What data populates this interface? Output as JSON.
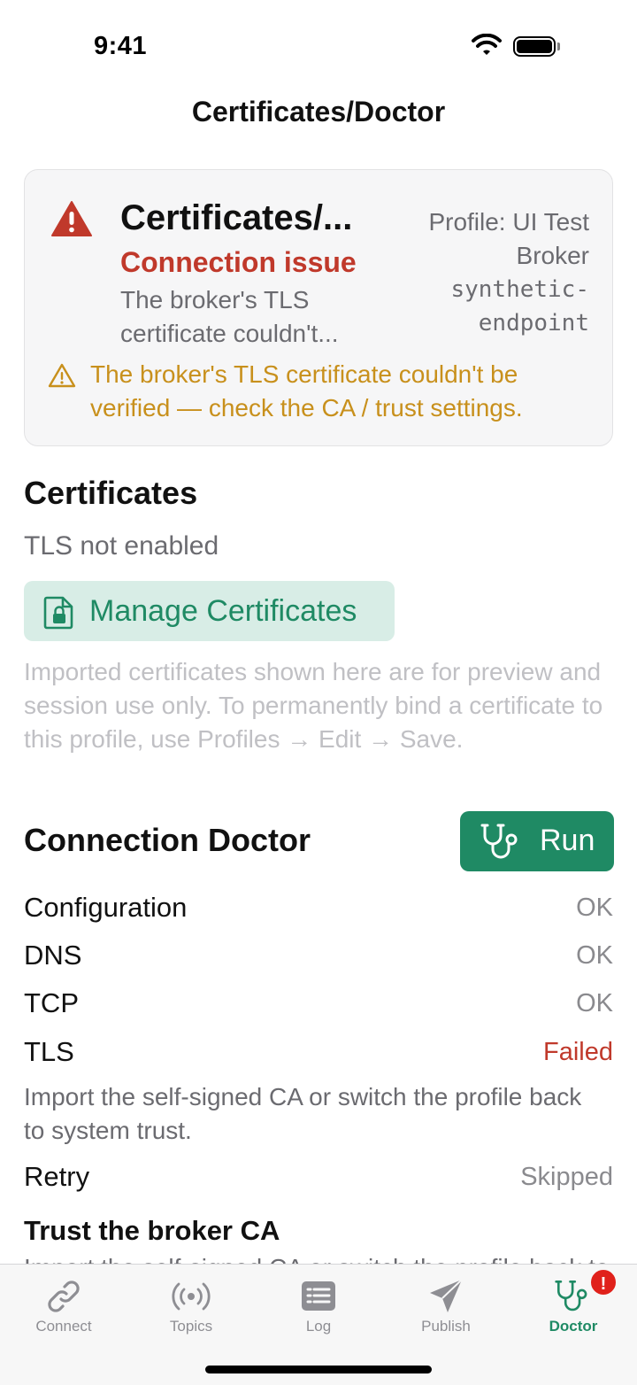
{
  "status_bar": {
    "time": "9:41"
  },
  "nav": {
    "title": "Certificates/Doctor"
  },
  "alert": {
    "title": "Certificates/...",
    "status": "Connection issue",
    "description": "The broker's TLS certificate couldn't...",
    "profile": "Profile: UI Test Broker",
    "endpoint": "synthetic-endpoint",
    "warning": "The broker's TLS certificate couldn't be verified — check the CA / trust settings."
  },
  "certificates": {
    "title": "Certificates",
    "status": "TLS not enabled",
    "manage_label": "Manage Certificates",
    "note": "Imported certificates shown here are for preview and session use only. To permanently bind a certificate to this profile, use Profiles → Edit → Save."
  },
  "doctor": {
    "title": "Connection Doctor",
    "run_label": "Run",
    "checks": [
      {
        "name": "Configuration",
        "value": "OK"
      },
      {
        "name": "DNS",
        "value": "OK"
      },
      {
        "name": "TCP",
        "value": "OK"
      },
      {
        "name": "TLS",
        "value": "Failed"
      },
      {
        "name": "Retry",
        "value": "Skipped"
      }
    ],
    "tls_hint": "Import the self-signed CA or switch the profile back to system trust.",
    "trust_title": "Trust the broker CA",
    "trust_desc": "Import the self-signed CA or switch the profile back to system trust."
  },
  "tabs": [
    {
      "label": "Connect",
      "icon": "link-icon"
    },
    {
      "label": "Topics",
      "icon": "broadcast-icon"
    },
    {
      "label": "Log",
      "icon": "log-icon"
    },
    {
      "label": "Publish",
      "icon": "send-icon"
    },
    {
      "label": "Doctor",
      "icon": "stethoscope-icon",
      "active": true
    }
  ],
  "tab_badge": "!",
  "colors": {
    "accent": "#1f8a64",
    "error": "#c0392b",
    "warning": "#c8901c",
    "badge": "#e0211b"
  }
}
